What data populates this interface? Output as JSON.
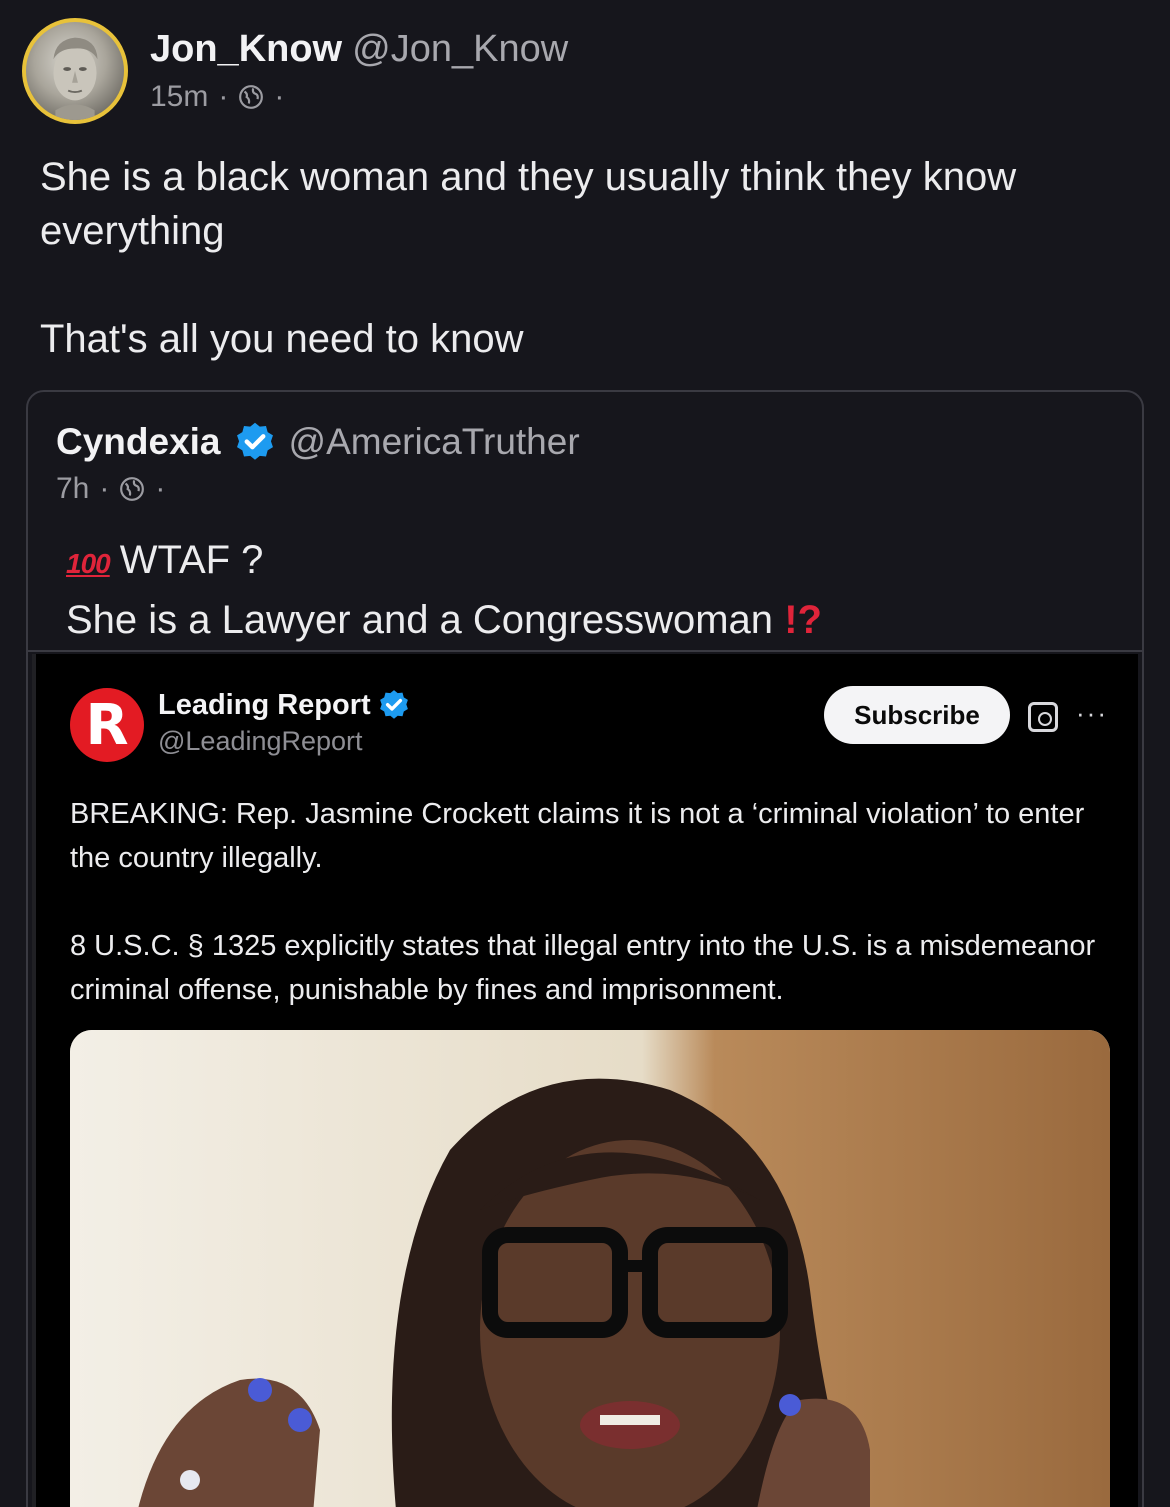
{
  "post": {
    "author_name": "Jon_Know",
    "author_handle": "@Jon_Know",
    "time": "15m",
    "separator": "·",
    "visibility_icon": "globe-icon",
    "body_lines": [
      "She is a black woman and they usually think they know everything",
      "That's all you need to know"
    ]
  },
  "quote": {
    "author_name": "Cyndexia",
    "author_handle": "@AmericaTruther",
    "verified_icon": "verified-badge-icon",
    "time": "7h",
    "separator": "·",
    "emoji_100": "💯",
    "line1": "WTAF ?",
    "line2": "She is a Lawyer and a Congresswoman",
    "interrobang": "⁉"
  },
  "embed": {
    "logo_letter": "R",
    "name": "Leading Report",
    "handle": "@LeadingReport",
    "subscribe_label": "Subscribe",
    "more_label": "···",
    "paragraph1": "BREAKING: Rep. Jasmine Crockett claims it is not a ‘criminal violation’ to enter the country illegally.",
    "paragraph2": "8 U.S.C. § 1325 explicitly states that illegal entry into the U.S. is a misdemeanor criminal offense, punishable by fines and imprisonment."
  },
  "colors": {
    "background": "#16161c",
    "avatar_ring": "#e8c23a",
    "verified_blue": "#1d9bf0",
    "accent_red": "#e0243a",
    "logo_red": "#e31b23"
  }
}
